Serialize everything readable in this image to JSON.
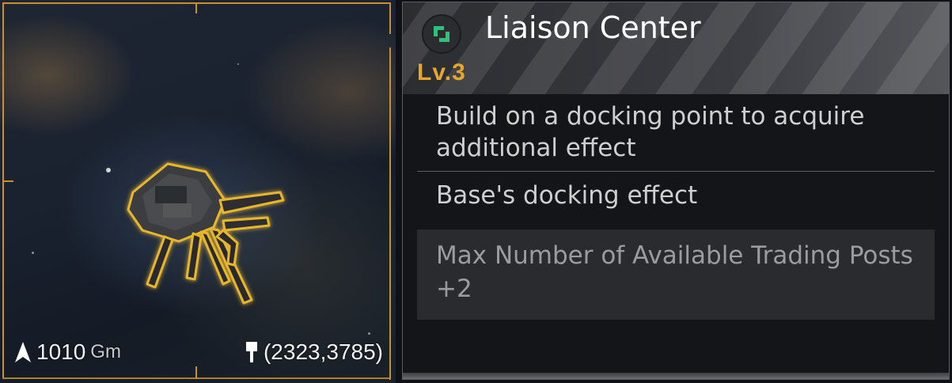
{
  "building": {
    "name": "Liaison Center",
    "level": "Lv.3",
    "description": "Build on a docking point to acquire additional effect",
    "section_label": "Base's docking effect",
    "effect": "Max Number of Available Trading Posts +2"
  },
  "hud": {
    "distance_value": "1010",
    "distance_unit": "Gm",
    "coordinates": "(2323,3785)"
  },
  "colors": {
    "accent": "#c98f2a",
    "level": "#e6a52c",
    "badge_icon": "#2fc07a"
  },
  "icons": {
    "badge": "building-type-icon",
    "distance": "navigation-arrow-icon",
    "location": "location-pin-icon"
  }
}
